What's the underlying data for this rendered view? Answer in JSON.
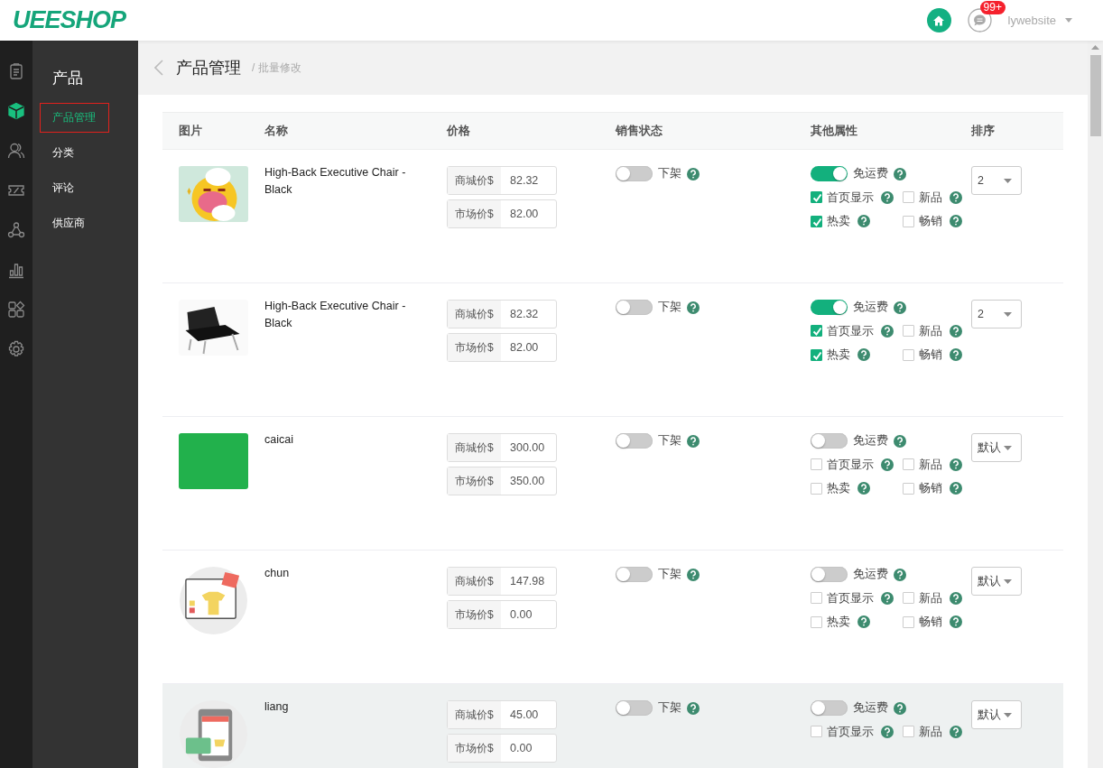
{
  "header": {
    "logo": "UEESHOP",
    "badge": "99+",
    "user": "lywebsite"
  },
  "rail": [
    {
      "selected": false
    },
    {
      "selected": true
    },
    {
      "selected": false
    },
    {
      "selected": false
    },
    {
      "selected": false
    },
    {
      "selected": false
    },
    {
      "selected": false
    },
    {
      "selected": false
    }
  ],
  "sidebar": {
    "title": "产品",
    "items": [
      {
        "label": "产品管理",
        "selected": true
      },
      {
        "label": "分类",
        "selected": false
      },
      {
        "label": "评论",
        "selected": false
      },
      {
        "label": "供应商",
        "selected": false
      }
    ]
  },
  "breadcrumb": {
    "title": "产品管理",
    "sub": "/ 批量修改"
  },
  "table": {
    "columns": [
      "图片",
      "名称",
      "价格",
      "销售状态",
      "其他属性",
      "排序"
    ],
    "rows": [
      {
        "image": {
          "kind": "picture"
        },
        "name": "High-Back Executive Chair - Black",
        "prices": [
          {
            "label": "商城价$",
            "value": "82.32"
          },
          {
            "label": "市场价$",
            "value": "82.00"
          }
        ],
        "status": {
          "label": "下架",
          "on": false
        },
        "shipping": {
          "label": "免运费",
          "on": true
        },
        "flags": [
          {
            "label": "首页显示",
            "checked": true
          },
          {
            "label": "新品",
            "checked": false
          },
          {
            "label": "热卖",
            "checked": true
          },
          {
            "label": "畅销",
            "checked": false
          }
        ],
        "sort": "2",
        "hover": false
      },
      {
        "image": {
          "kind": "picture"
        },
        "name": "High-Back Executive Chair - Black",
        "prices": [
          {
            "label": "商城价$",
            "value": "82.32"
          },
          {
            "label": "市场价$",
            "value": "82.00"
          }
        ],
        "status": {
          "label": "下架",
          "on": false
        },
        "shipping": {
          "label": "免运费",
          "on": true
        },
        "flags": [
          {
            "label": "首页显示",
            "checked": true
          },
          {
            "label": "新品",
            "checked": false
          },
          {
            "label": "热卖",
            "checked": true
          },
          {
            "label": "畅销",
            "checked": false
          }
        ],
        "sort": "2",
        "hover": false
      },
      {
        "image": {
          "kind": "swatch",
          "color": "#22b14c"
        },
        "name": "caicai",
        "prices": [
          {
            "label": "商城价$",
            "value": "300.00"
          },
          {
            "label": "市场价$",
            "value": "350.00"
          }
        ],
        "status": {
          "label": "下架",
          "on": false
        },
        "shipping": {
          "label": "免运费",
          "on": false
        },
        "flags": [
          {
            "label": "首页显示",
            "checked": false
          },
          {
            "label": "新品",
            "checked": false
          },
          {
            "label": "热卖",
            "checked": false
          },
          {
            "label": "畅销",
            "checked": false
          }
        ],
        "sort": "默认",
        "hover": false
      },
      {
        "image": {
          "kind": "picture"
        },
        "name": "chun",
        "prices": [
          {
            "label": "商城价$",
            "value": "147.98"
          },
          {
            "label": "市场价$",
            "value": "0.00"
          }
        ],
        "status": {
          "label": "下架",
          "on": false
        },
        "shipping": {
          "label": "免运费",
          "on": false
        },
        "flags": [
          {
            "label": "首页显示",
            "checked": false
          },
          {
            "label": "新品",
            "checked": false
          },
          {
            "label": "热卖",
            "checked": false
          },
          {
            "label": "畅销",
            "checked": false
          }
        ],
        "sort": "默认",
        "hover": false
      },
      {
        "image": {
          "kind": "picture"
        },
        "name": "liang",
        "prices": [
          {
            "label": "商城价$",
            "value": "45.00"
          },
          {
            "label": "市场价$",
            "value": "0.00"
          }
        ],
        "status": {
          "label": "下架",
          "on": false
        },
        "shipping": {
          "label": "免运费",
          "on": false
        },
        "flags": [
          {
            "label": "首页显示",
            "checked": false
          },
          {
            "label": "新品",
            "checked": false
          }
        ],
        "sort": "默认",
        "hover": true
      }
    ]
  }
}
